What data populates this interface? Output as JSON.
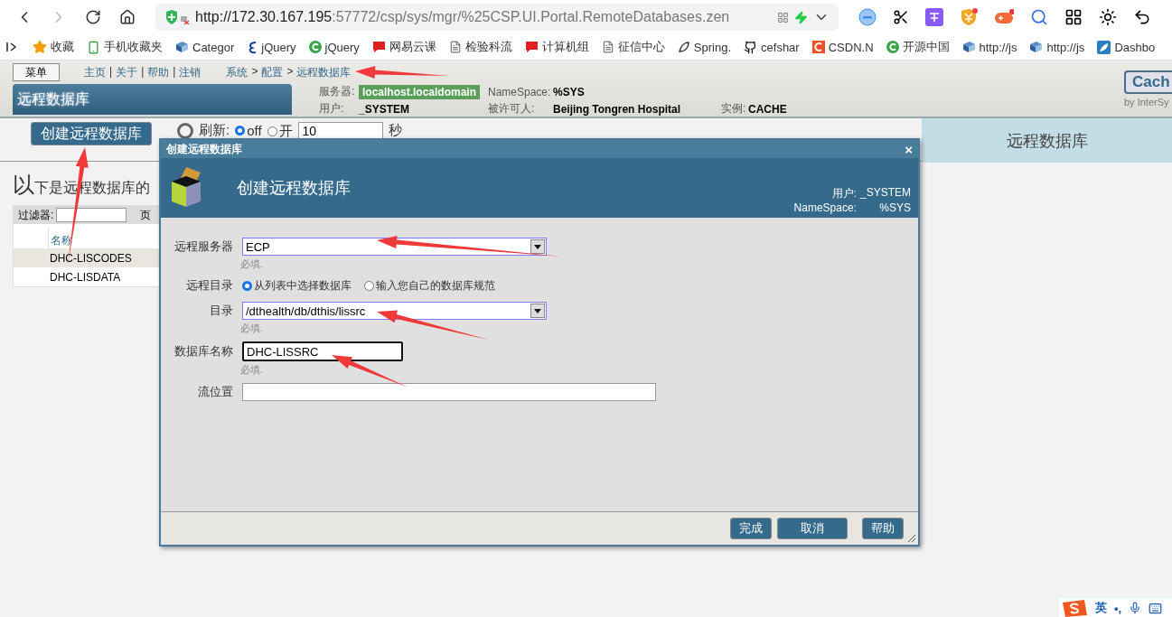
{
  "browser": {
    "url_host": "http://172.30.167.195",
    "url_rest": ":57772/csp/sys/mgr/%25CSP.UI.Portal.RemoteDatabases.zen"
  },
  "bookmarks": [
    {
      "label": "收藏",
      "kind": "star"
    },
    {
      "label": "手机收藏夹",
      "kind": "phone"
    },
    {
      "label": "Categor",
      "kind": "site"
    },
    {
      "label": "jQuery",
      "kind": "script"
    },
    {
      "label": "jQuery",
      "kind": "green"
    },
    {
      "label": "网易云课",
      "kind": "red"
    },
    {
      "label": "检验科流",
      "kind": "doc"
    },
    {
      "label": "计算机组",
      "kind": "red"
    },
    {
      "label": "征信中心",
      "kind": "doc"
    },
    {
      "label": "Spring.",
      "kind": "leaf"
    },
    {
      "label": "cefshar",
      "kind": "github"
    },
    {
      "label": "CSDN.N",
      "kind": "csdn"
    },
    {
      "label": "开源中国",
      "kind": "green"
    },
    {
      "label": "http://js",
      "kind": "site"
    },
    {
      "label": "http://js",
      "kind": "site"
    },
    {
      "label": "Dashbo",
      "kind": "blue"
    }
  ],
  "portal": {
    "menu_button": "菜单",
    "links": [
      {
        "label": "主页"
      },
      {
        "label": "关于",
        "separator": "|"
      },
      {
        "label": "帮助",
        "separator": "|"
      },
      {
        "label": "注销",
        "separator": "|"
      }
    ],
    "breadcrumb": [
      {
        "label": "系统"
      },
      {
        "label": "配置",
        "separator": ">"
      },
      {
        "label": "远程数据库",
        "separator": ">"
      }
    ],
    "title": "远程数据库",
    "info_rows": [
      [
        {
          "label": "服务器:",
          "value": "localhost.localdomain",
          "kind": "badge"
        },
        {
          "label": "NameSpace:",
          "value": "%SYS",
          "kind": "plain"
        }
      ],
      [
        {
          "label": "用户:",
          "value": "_SYSTEM",
          "kind": "plain"
        },
        {
          "label": "被许可人:",
          "value": "Beijing Tongren Hospital",
          "kind": "plain"
        },
        {
          "label": "实例:",
          "value": "CACHE",
          "kind": "plain"
        }
      ]
    ],
    "logo": "Cach",
    "logo_sub": "by InterSy"
  },
  "toolbar": {
    "create_button": "创建远程数据库",
    "refresh_label": "刷新:",
    "refresh_options": [
      {
        "label": "off",
        "selected": true
      },
      {
        "label": "开",
        "selected": false
      }
    ],
    "interval": "10",
    "unit": "秒"
  },
  "side_pane": {
    "title": "远程数据库"
  },
  "content": {
    "heading": "以下是远程数据库的",
    "filter_label": "过滤器:",
    "page_label": "页",
    "table": {
      "columns": [
        "名称"
      ],
      "rows": [
        {
          "cells": [
            "DHC-LISCODES"
          ],
          "selected": true
        },
        {
          "cells": [
            "DHC-LISDATA"
          ],
          "selected": false
        }
      ]
    }
  },
  "dialog": {
    "title": "创建远程数据库",
    "close": "×",
    "heading": "创建远程数据库",
    "info": [
      {
        "label": "用户:",
        "value": "_SYSTEM"
      },
      {
        "label": "NameSpace:",
        "value": "%SYS"
      }
    ],
    "fields": [
      {
        "kind": "select",
        "label": "远程服务器",
        "value": "ECP",
        "hint": "必填."
      },
      {
        "kind": "radio",
        "label": "远程目录",
        "options": [
          {
            "label": "从列表中选择数据库",
            "selected": true
          },
          {
            "label": "输入您自己的数据库规范",
            "selected": false
          }
        ]
      },
      {
        "kind": "select",
        "label": "目录",
        "value": "/dthealth/db/dthis/lissrc",
        "hint": "必填."
      },
      {
        "kind": "text",
        "label": "数据库名称",
        "value": "DHC-LISSRC",
        "hint": "必填.",
        "focused": true
      },
      {
        "kind": "text",
        "label": "流位置",
        "focused": false
      }
    ],
    "buttons": [
      "完成",
      "取消",
      "帮助"
    ]
  },
  "ime": {
    "mode": "英",
    "punct": "•,"
  }
}
